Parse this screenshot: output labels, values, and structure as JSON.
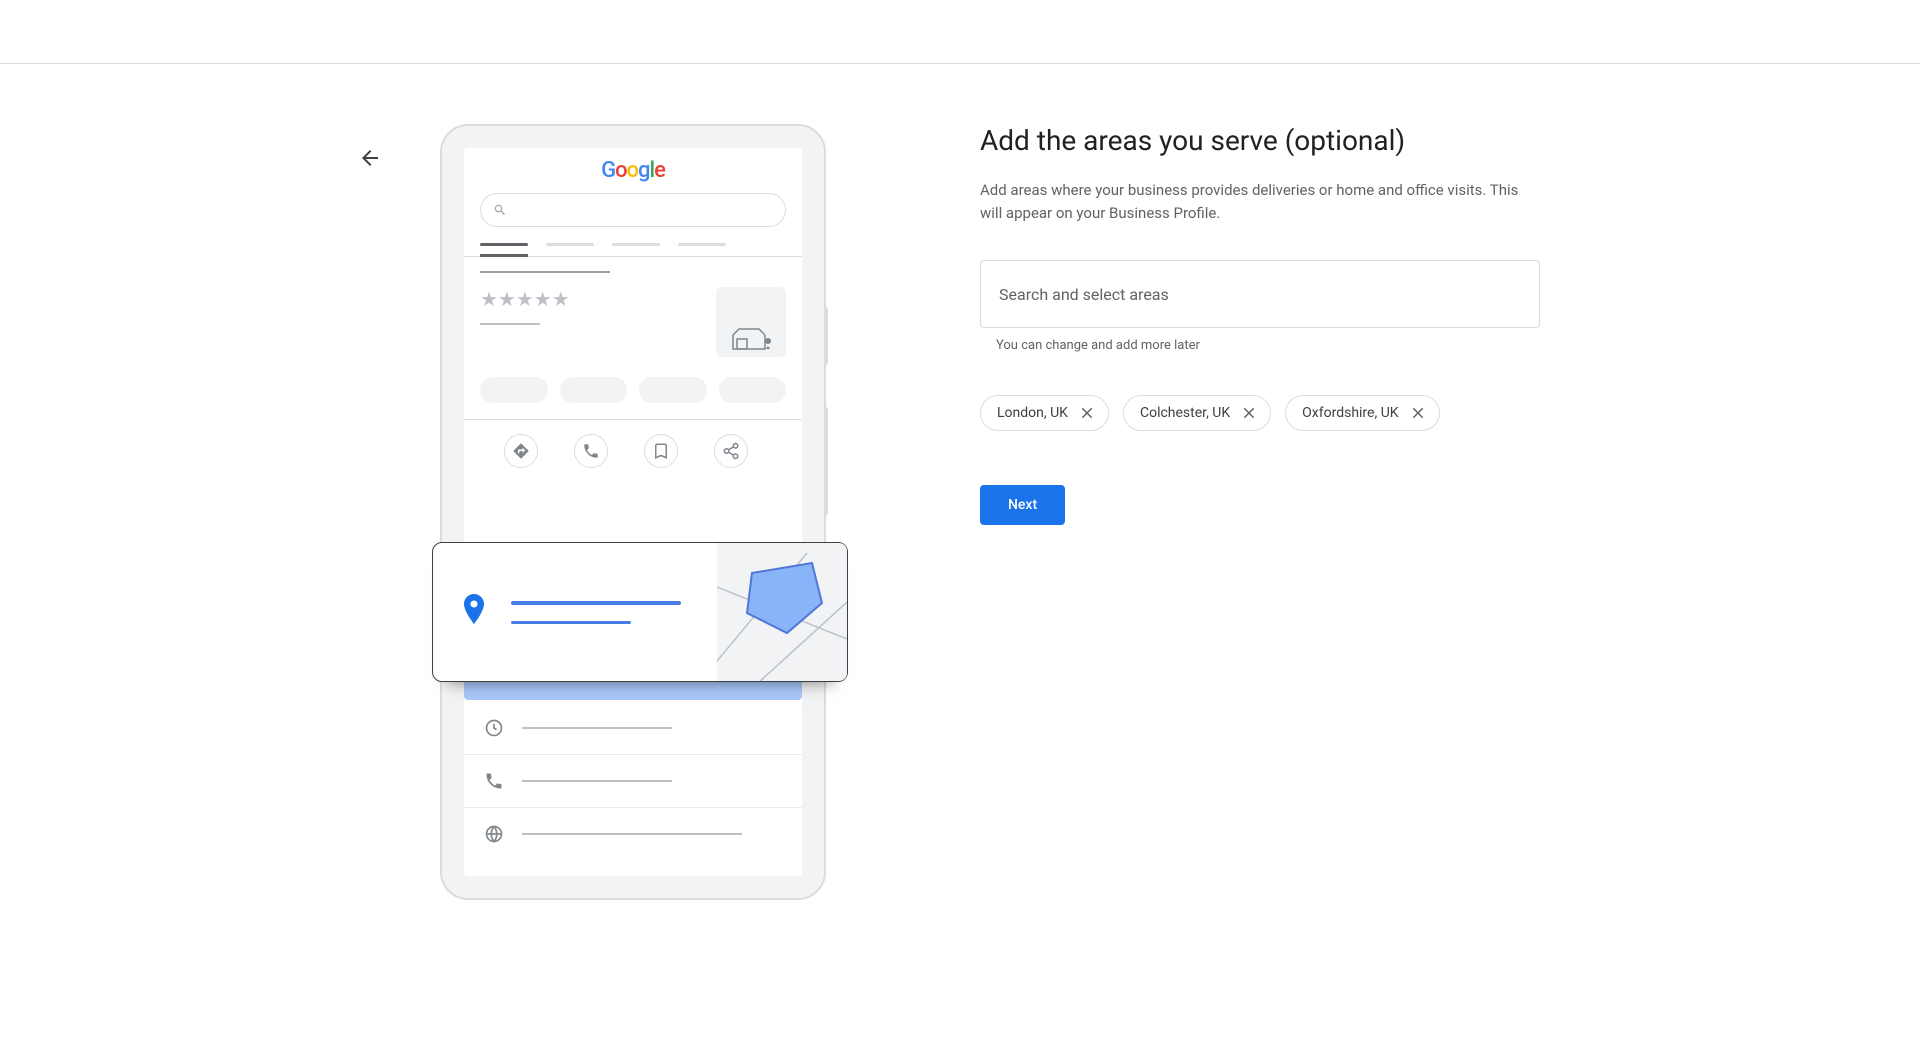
{
  "heading": "Add the areas you serve (optional)",
  "description": "Add areas where your business provides deliveries or home and office visits. This will appear on your Business Profile.",
  "search": {
    "placeholder": "Search and select areas",
    "helper": "You can change and add more later"
  },
  "chips": [
    {
      "label": "London, UK"
    },
    {
      "label": "Colchester, UK"
    },
    {
      "label": "Oxfordshire, UK"
    }
  ],
  "buttons": {
    "next": "Next"
  },
  "illustration": {
    "logo": "Google"
  }
}
